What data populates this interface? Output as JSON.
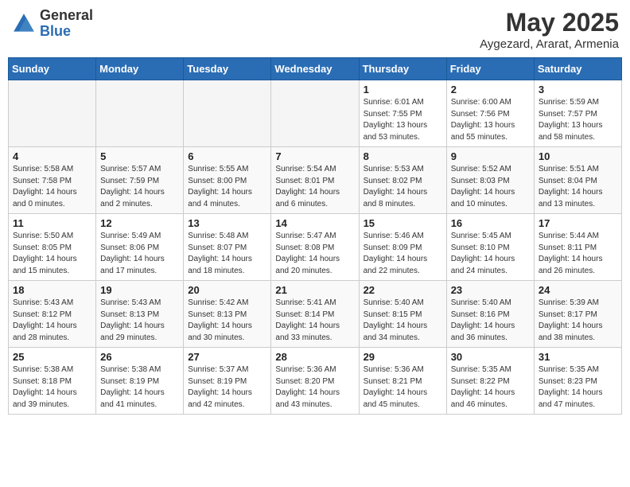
{
  "header": {
    "logo_general": "General",
    "logo_blue": "Blue",
    "title": "May 2025",
    "location": "Aygezard, Ararat, Armenia"
  },
  "weekdays": [
    "Sunday",
    "Monday",
    "Tuesday",
    "Wednesday",
    "Thursday",
    "Friday",
    "Saturday"
  ],
  "weeks": [
    [
      {
        "day": "",
        "info": ""
      },
      {
        "day": "",
        "info": ""
      },
      {
        "day": "",
        "info": ""
      },
      {
        "day": "",
        "info": ""
      },
      {
        "day": "1",
        "info": "Sunrise: 6:01 AM\nSunset: 7:55 PM\nDaylight: 13 hours\nand 53 minutes."
      },
      {
        "day": "2",
        "info": "Sunrise: 6:00 AM\nSunset: 7:56 PM\nDaylight: 13 hours\nand 55 minutes."
      },
      {
        "day": "3",
        "info": "Sunrise: 5:59 AM\nSunset: 7:57 PM\nDaylight: 13 hours\nand 58 minutes."
      }
    ],
    [
      {
        "day": "4",
        "info": "Sunrise: 5:58 AM\nSunset: 7:58 PM\nDaylight: 14 hours\nand 0 minutes."
      },
      {
        "day": "5",
        "info": "Sunrise: 5:57 AM\nSunset: 7:59 PM\nDaylight: 14 hours\nand 2 minutes."
      },
      {
        "day": "6",
        "info": "Sunrise: 5:55 AM\nSunset: 8:00 PM\nDaylight: 14 hours\nand 4 minutes."
      },
      {
        "day": "7",
        "info": "Sunrise: 5:54 AM\nSunset: 8:01 PM\nDaylight: 14 hours\nand 6 minutes."
      },
      {
        "day": "8",
        "info": "Sunrise: 5:53 AM\nSunset: 8:02 PM\nDaylight: 14 hours\nand 8 minutes."
      },
      {
        "day": "9",
        "info": "Sunrise: 5:52 AM\nSunset: 8:03 PM\nDaylight: 14 hours\nand 10 minutes."
      },
      {
        "day": "10",
        "info": "Sunrise: 5:51 AM\nSunset: 8:04 PM\nDaylight: 14 hours\nand 13 minutes."
      }
    ],
    [
      {
        "day": "11",
        "info": "Sunrise: 5:50 AM\nSunset: 8:05 PM\nDaylight: 14 hours\nand 15 minutes."
      },
      {
        "day": "12",
        "info": "Sunrise: 5:49 AM\nSunset: 8:06 PM\nDaylight: 14 hours\nand 17 minutes."
      },
      {
        "day": "13",
        "info": "Sunrise: 5:48 AM\nSunset: 8:07 PM\nDaylight: 14 hours\nand 18 minutes."
      },
      {
        "day": "14",
        "info": "Sunrise: 5:47 AM\nSunset: 8:08 PM\nDaylight: 14 hours\nand 20 minutes."
      },
      {
        "day": "15",
        "info": "Sunrise: 5:46 AM\nSunset: 8:09 PM\nDaylight: 14 hours\nand 22 minutes."
      },
      {
        "day": "16",
        "info": "Sunrise: 5:45 AM\nSunset: 8:10 PM\nDaylight: 14 hours\nand 24 minutes."
      },
      {
        "day": "17",
        "info": "Sunrise: 5:44 AM\nSunset: 8:11 PM\nDaylight: 14 hours\nand 26 minutes."
      }
    ],
    [
      {
        "day": "18",
        "info": "Sunrise: 5:43 AM\nSunset: 8:12 PM\nDaylight: 14 hours\nand 28 minutes."
      },
      {
        "day": "19",
        "info": "Sunrise: 5:43 AM\nSunset: 8:13 PM\nDaylight: 14 hours\nand 29 minutes."
      },
      {
        "day": "20",
        "info": "Sunrise: 5:42 AM\nSunset: 8:13 PM\nDaylight: 14 hours\nand 30 minutes."
      },
      {
        "day": "21",
        "info": "Sunrise: 5:41 AM\nSunset: 8:14 PM\nDaylight: 14 hours\nand 33 minutes."
      },
      {
        "day": "22",
        "info": "Sunrise: 5:40 AM\nSunset: 8:15 PM\nDaylight: 14 hours\nand 34 minutes."
      },
      {
        "day": "23",
        "info": "Sunrise: 5:40 AM\nSunset: 8:16 PM\nDaylight: 14 hours\nand 36 minutes."
      },
      {
        "day": "24",
        "info": "Sunrise: 5:39 AM\nSunset: 8:17 PM\nDaylight: 14 hours\nand 38 minutes."
      }
    ],
    [
      {
        "day": "25",
        "info": "Sunrise: 5:38 AM\nSunset: 8:18 PM\nDaylight: 14 hours\nand 39 minutes."
      },
      {
        "day": "26",
        "info": "Sunrise: 5:38 AM\nSunset: 8:19 PM\nDaylight: 14 hours\nand 41 minutes."
      },
      {
        "day": "27",
        "info": "Sunrise: 5:37 AM\nSunset: 8:19 PM\nDaylight: 14 hours\nand 42 minutes."
      },
      {
        "day": "28",
        "info": "Sunrise: 5:36 AM\nSunset: 8:20 PM\nDaylight: 14 hours\nand 43 minutes."
      },
      {
        "day": "29",
        "info": "Sunrise: 5:36 AM\nSunset: 8:21 PM\nDaylight: 14 hours\nand 45 minutes."
      },
      {
        "day": "30",
        "info": "Sunrise: 5:35 AM\nSunset: 8:22 PM\nDaylight: 14 hours\nand 46 minutes."
      },
      {
        "day": "31",
        "info": "Sunrise: 5:35 AM\nSunset: 8:23 PM\nDaylight: 14 hours\nand 47 minutes."
      }
    ]
  ]
}
